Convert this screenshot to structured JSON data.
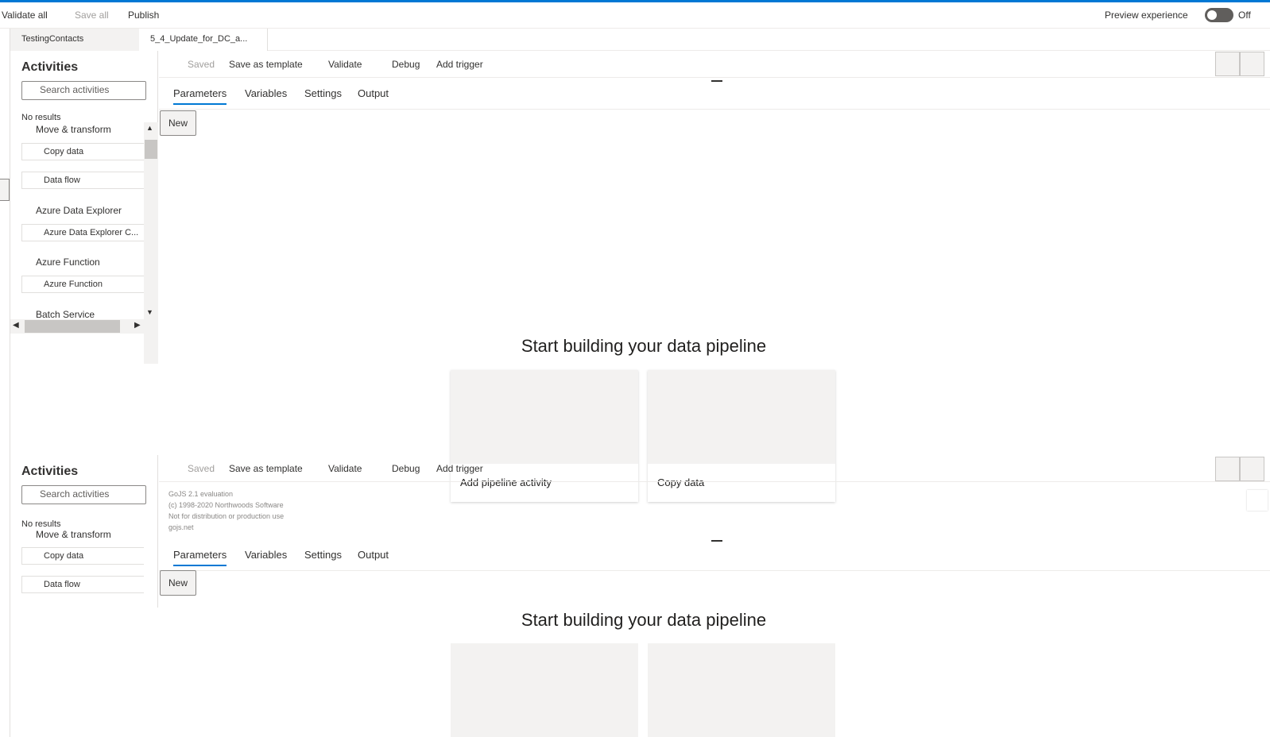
{
  "topbar": {
    "validate_all": "Validate all",
    "save_all": "Save all",
    "publish": "Publish",
    "preview_experience": "Preview experience",
    "toggle_state": "Off"
  },
  "doc_tabs": [
    "TestingContacts",
    "5_4_Update_for_DC_a..."
  ],
  "activities": {
    "title": "Activities",
    "search_placeholder": "Search activities",
    "no_results": "No results",
    "groups": {
      "move_transform": "Move & transform",
      "azure_data_explorer": "Azure Data Explorer",
      "azure_function": "Azure Function",
      "batch_service": "Batch Service"
    },
    "items": {
      "copy_data": "Copy data",
      "data_flow": "Data flow",
      "azure_data_explorer_cmd": "Azure Data Explorer C...",
      "azure_function": "Azure Function"
    }
  },
  "pipeline_toolbar": {
    "saved": "Saved",
    "save_as_template": "Save as template",
    "validate": "Validate",
    "debug": "Debug",
    "add_trigger": "Add trigger"
  },
  "sub_tabs": [
    "Parameters",
    "Variables",
    "Settings",
    "Output"
  ],
  "new_button": "New",
  "canvas": {
    "title": "Start building your data pipeline",
    "cards": [
      "Add pipeline activity",
      "Copy data"
    ]
  },
  "gojs_watermark": [
    "GoJS 2.1 evaluation",
    "(c) 1998-2020 Northwoods Software",
    "Not for distribution or production use",
    "gojs.net"
  ],
  "colors": {
    "accent": "#0078d4",
    "text": "#323130",
    "disabled": "#a19f9d",
    "card_bg": "#f3f2f1"
  }
}
